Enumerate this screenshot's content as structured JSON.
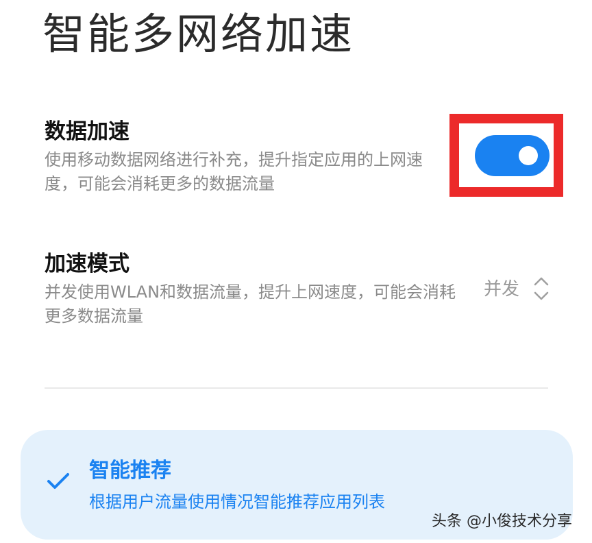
{
  "page": {
    "title": "智能多网络加速"
  },
  "settings": {
    "data_acceleration": {
      "title": "数据加速",
      "description": "使用移动数据网络进行补充，提升指定应用的上网速度，可能会消耗更多的数据流量",
      "enabled": true
    },
    "acceleration_mode": {
      "title": "加速模式",
      "description": "并发使用WLAN和数据流量，提升上网速度，可能会消耗更多数据流量",
      "value": "并发"
    }
  },
  "recommendation": {
    "title": "智能推荐",
    "description": "根据用户流量使用情况智能推荐应用列表",
    "checked": true
  },
  "watermark": "头条 @小俊技术分享",
  "icons": {
    "toggle": "toggle-switch",
    "mode": "chevron-up-down-icon",
    "check": "check-icon"
  },
  "colors": {
    "accent": "#1a82f1",
    "highlight_box": "#ec2a2a",
    "card_background": "#e4f1fc"
  }
}
